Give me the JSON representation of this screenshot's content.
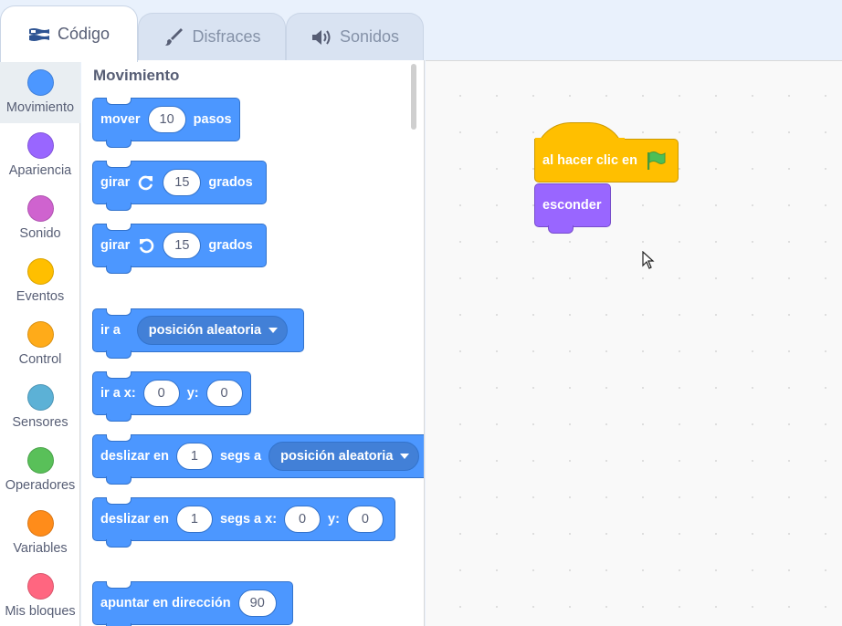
{
  "tabs": [
    {
      "label": "Código",
      "icon": "code-icon",
      "active": true
    },
    {
      "label": "Disfraces",
      "icon": "brush-icon",
      "active": false
    },
    {
      "label": "Sonidos",
      "icon": "speaker-icon",
      "active": false
    }
  ],
  "categories": [
    {
      "label": "Movimiento",
      "color": "#4c97ff"
    },
    {
      "label": "Apariencia",
      "color": "#9966ff"
    },
    {
      "label": "Sonido",
      "color": "#cf63cf"
    },
    {
      "label": "Eventos",
      "color": "#ffbf00"
    },
    {
      "label": "Control",
      "color": "#ffab19"
    },
    {
      "label": "Sensores",
      "color": "#5cb1d6"
    },
    {
      "label": "Operadores",
      "color": "#59c059"
    },
    {
      "label": "Variables",
      "color": "#ff8c1a"
    },
    {
      "label": "Mis bloques",
      "color": "#ff6680"
    }
  ],
  "palette": {
    "title": "Movimiento",
    "move": {
      "label": "mover",
      "value": "10",
      "suffix": "pasos"
    },
    "turn_right": {
      "label": "girar",
      "value": "15",
      "suffix": "grados"
    },
    "turn_left": {
      "label": "girar",
      "value": "15",
      "suffix": "grados"
    },
    "goto": {
      "label": "ir a",
      "dropdown": "posición aleatoria"
    },
    "goto_xy": {
      "label": "ir a x:",
      "x": "0",
      "ylabel": "y:",
      "y": "0"
    },
    "glide_to": {
      "label": "deslizar en",
      "secs": "1",
      "mid": "segs a",
      "dropdown": "posición aleatoria"
    },
    "glide_xy": {
      "label": "deslizar en",
      "secs": "1",
      "mid": "segs a x:",
      "x": "0",
      "ylabel": "y:",
      "y": "0"
    },
    "point_dir": {
      "label": "apuntar en dirección",
      "value": "90"
    }
  },
  "workspace": {
    "hat_label": "al hacer clic en",
    "hat_icon": "green-flag-icon",
    "looks_label": "esconder"
  },
  "colors": {
    "motion": "#4c97ff",
    "events": "#ffbf00",
    "looks": "#9966ff"
  }
}
